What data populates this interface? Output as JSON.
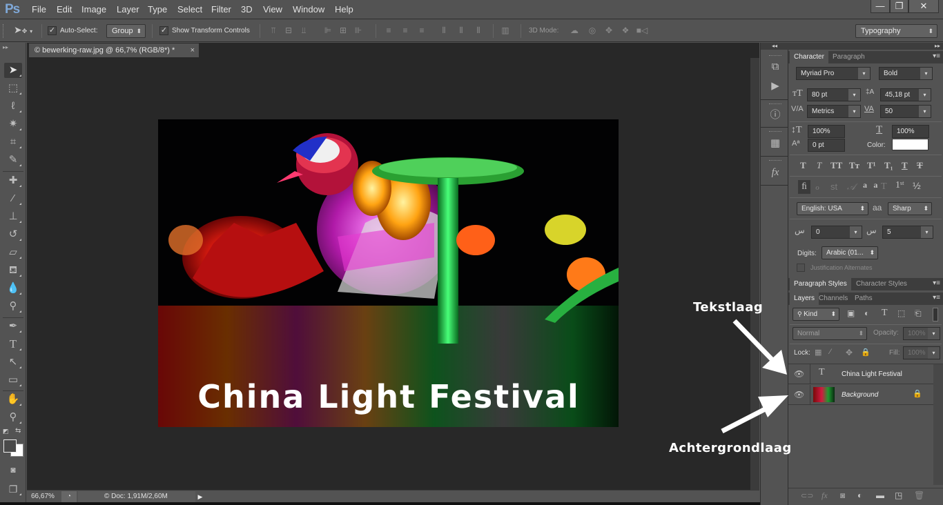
{
  "app": {
    "logo": "Ps"
  },
  "menubar": {
    "items": [
      "File",
      "Edit",
      "Image",
      "Layer",
      "Type",
      "Select",
      "Filter",
      "3D",
      "View",
      "Window",
      "Help"
    ],
    "window_controls": {
      "minimize": "—",
      "restore": "❐",
      "close": "✕"
    }
  },
  "options_bar": {
    "tool_icon": "move-tool-icon",
    "auto_select_label": "Auto-Select:",
    "auto_select_checked": true,
    "auto_select_value": "Group",
    "show_transform_label": "Show Transform Controls",
    "show_transform_checked": true,
    "mode_3d_label": "3D Mode:",
    "workspace": "Typography"
  },
  "document": {
    "tab_title": "© bewerking-raw.jpg @ 66,7% (RGB/8*) *",
    "close": "×",
    "overlay_text": "China Light Festival",
    "zoom": "66,67%",
    "doc_info": "© Doc: 1,91M/2,60M"
  },
  "tools": [
    "move-tool",
    "rectangular-marquee-tool",
    "lasso-tool",
    "magic-wand-tool",
    "crop-tool",
    "eyedropper-tool",
    "spot-healing-tool",
    "brush-tool",
    "clone-stamp-tool",
    "history-brush-tool",
    "eraser-tool",
    "paint-bucket-tool",
    "blur-tool",
    "dodge-tool",
    "pen-tool",
    "type-tool",
    "path-selection-tool",
    "rectangle-tool",
    "hand-tool",
    "zoom-tool"
  ],
  "character_panel": {
    "tabs": [
      "Character",
      "Paragraph"
    ],
    "font_family": "Myriad Pro",
    "font_style": "Bold",
    "font_size": "80 pt",
    "leading": "45,18 pt",
    "kerning": "Metrics",
    "tracking": "50",
    "vertical_scale": "100%",
    "horizontal_scale": "100%",
    "baseline_shift": "0 pt",
    "color_label": "Color:",
    "color": "#ffffff",
    "language": "English: USA",
    "antialias_icon": "aa",
    "antialias": "Sharp",
    "kashida_1": "0",
    "kashida_2": "5",
    "digits_label": "Digits:",
    "digits": "Arabic (01...",
    "justification_alternates": "Justification Alternates"
  },
  "styles_tabs": [
    "Paragraph Styles",
    "Character Styles"
  ],
  "layers_panel": {
    "tabs": [
      "Layers",
      "Channels",
      "Paths"
    ],
    "filter": "Kind",
    "blend_mode": "Normal",
    "opacity_label": "Opacity:",
    "opacity": "100%",
    "lock_label": "Lock:",
    "fill_label": "Fill:",
    "fill": "100%",
    "layers": [
      {
        "name": "China Light Festival",
        "type": "text",
        "visible": true
      },
      {
        "name": "Background",
        "type": "image",
        "visible": true,
        "locked": true
      }
    ]
  },
  "annotations": {
    "text_layer": "Tekstlaag",
    "background_layer": "Achtergrondlaag"
  }
}
